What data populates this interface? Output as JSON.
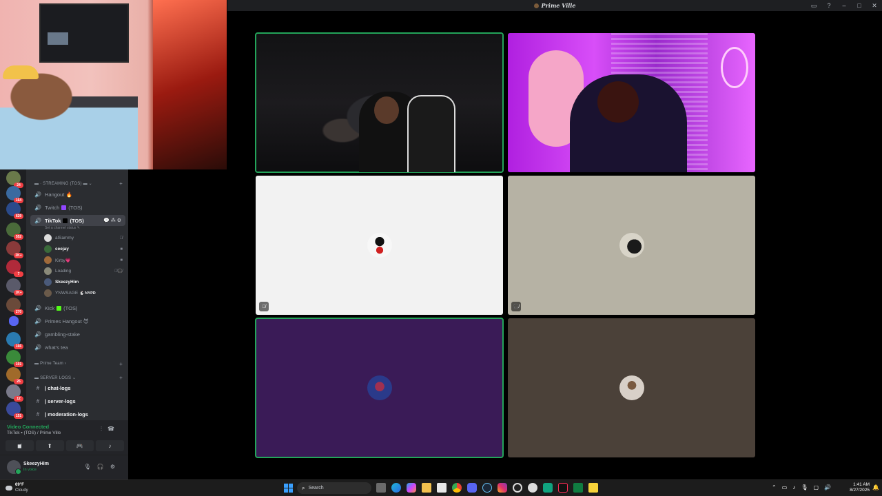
{
  "window": {
    "title": "Prime Ville",
    "controls": [
      "▭",
      "?",
      "–",
      "□",
      "✕"
    ]
  },
  "server_rail": {
    "badges": [
      "24",
      "164",
      "629",
      "552",
      "2K+",
      "7",
      "1K+",
      "270",
      "166",
      "101",
      "26",
      "12",
      "151"
    ]
  },
  "categories": {
    "streaming": "STREAMING (TOS)",
    "prime_team": "Prime Team",
    "server_logs": "SERVER LOGS"
  },
  "channels": {
    "hangout": "Hangout 🔥",
    "twitch": "Twitch",
    "twitch_suffix": "(TOS)",
    "tiktok": "TikTok",
    "tiktok_suffix": "(TOS)",
    "tiktok_status": "Set a channel status ✎",
    "kick": "Kick",
    "kick_suffix": "(TOS)",
    "primes_hangout": "Primes Hangout 😈",
    "gambling": "gambling-stake",
    "whats_tea": "what's tea",
    "chat_logs": "| chat-logs",
    "server_logs": "| server-logs",
    "moderation_logs": "| moderation-logs"
  },
  "voice_users": [
    {
      "name": "alSammy",
      "bold": false
    },
    {
      "name": "ceejay",
      "bold": true
    },
    {
      "name": "Kirby💗",
      "bold": false
    },
    {
      "name": "Loading",
      "bold": false
    },
    {
      "name": "SkeezyHim",
      "bold": true
    },
    {
      "name": "YNWSAGE",
      "bold": false
    }
  ],
  "voice_user_tag": "🐇 NYPD",
  "voice_panel": {
    "status": "Video Connected",
    "channel": "TikTok ▪ (TOS) / Prime Ville"
  },
  "user_panel": {
    "name": "SkeezyHim",
    "status": "In voice"
  },
  "taskbar": {
    "weather_temp": "69°F",
    "weather_desc": "Cloudy",
    "search_placeholder": "Search",
    "time": "1:41 AM",
    "date": "8/27/2025"
  },
  "colors": {
    "speaking": "#23a55a",
    "tile_white": "#f2f2f2",
    "tile_beige": "#b6b2a4",
    "tile_purple": "#3a1b57",
    "tile_brown": "#4b4139"
  }
}
